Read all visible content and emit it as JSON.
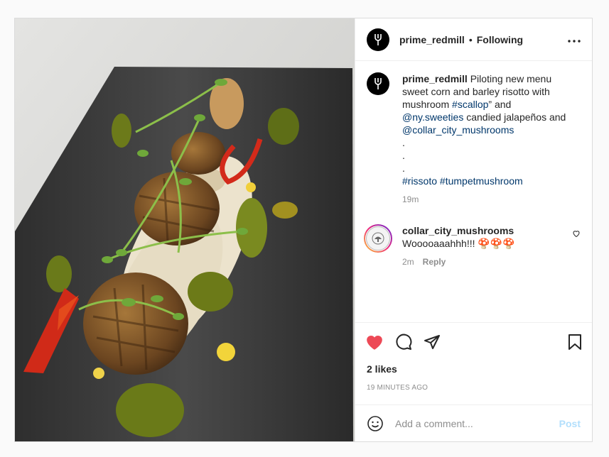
{
  "photo": {
    "alt_icon": "food-photo"
  },
  "header": {
    "username": "prime_redmill",
    "separator": "•",
    "follow_label": "Following",
    "more_icon": "more-horizontal-icon"
  },
  "caption": {
    "username": "prime_redmill",
    "text_1": "Piloting new menu sweet corn and barley risotto with mushroom ",
    "hashtag_scallop": "#scallop",
    "text_2": "” and ",
    "mention_1": "@ny.sweeties",
    "text_3": " candied jalapeños and ",
    "mention_2": "@collar_city_mushrooms",
    "dot_1": ".",
    "dot_2": ".",
    "dot_3": ".",
    "hashtag_risotto": "#rissoto",
    "hashtag_tumpet": "#tumpetmushroom",
    "time": "19m"
  },
  "comment": {
    "username": "collar_city_mushrooms",
    "text": "Wooooaaahhh!!! 🍄🍄🍄",
    "time": "2m",
    "reply_label": "Reply"
  },
  "actions": {
    "like_color": "#ed4956"
  },
  "likes_label": "2 likes",
  "timestamp": "19 MINUTES AGO",
  "add_comment": {
    "placeholder": "Add a comment...",
    "post_label": "Post",
    "post_color": "#b2dffc"
  }
}
